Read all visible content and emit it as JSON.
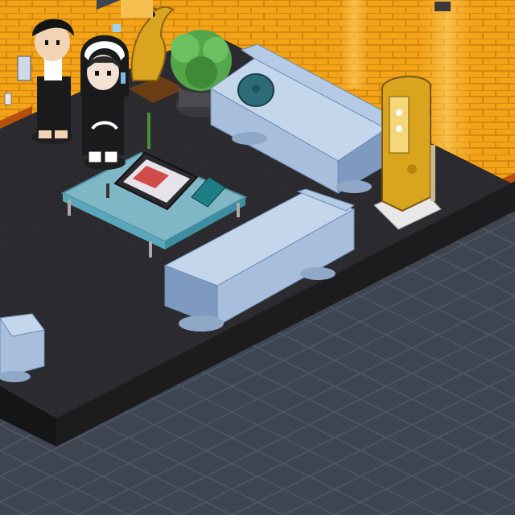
{
  "scene": {
    "colors": {
      "outer_floor": "#3e4450",
      "outer_floor_line": "#4c5462",
      "platform_top": "#2b2b2f",
      "platform_side": "#1c1c1f",
      "wall": "#f2a318",
      "wall_light": "#fbb938",
      "wall_line": "#c97f0a",
      "wall_base": "#b64e0c",
      "sofa": "#a7bfdc",
      "sofa_light": "#c4d6ec",
      "sofa_dark": "#7f9ac0",
      "gold": "#d9a51e",
      "plant": "#54a64a",
      "glass": "#8fd0e0"
    },
    "avatars": [
      {
        "id": "avatar-boy",
        "outfit": "black"
      },
      {
        "id": "avatar-girl",
        "outfit": "black-with-white-hood"
      }
    ],
    "furniture": [
      "dragon-statue",
      "potted-plant",
      "sofa-back",
      "sofa-front",
      "sofa-left-edge",
      "glass-coffee-table",
      "tablet-on-table",
      "gold-arcade-cabinet",
      "teal-cushion",
      "light-switch"
    ]
  }
}
